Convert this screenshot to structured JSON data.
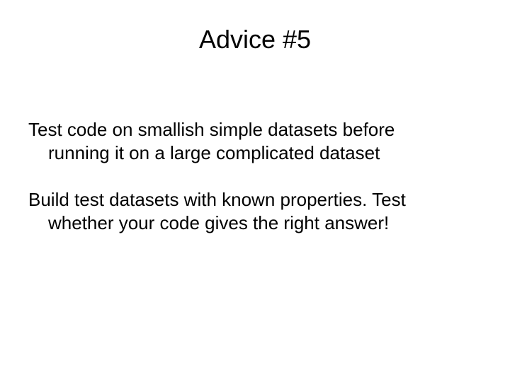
{
  "slide": {
    "title": "Advice #5",
    "paragraphs": [
      {
        "line1": "Test code on smallish simple datasets before",
        "line2": "running it on a large complicated dataset"
      },
      {
        "line1": "Build test datasets with known properties.  Test",
        "line2": "whether your code gives the right answer!"
      }
    ]
  }
}
